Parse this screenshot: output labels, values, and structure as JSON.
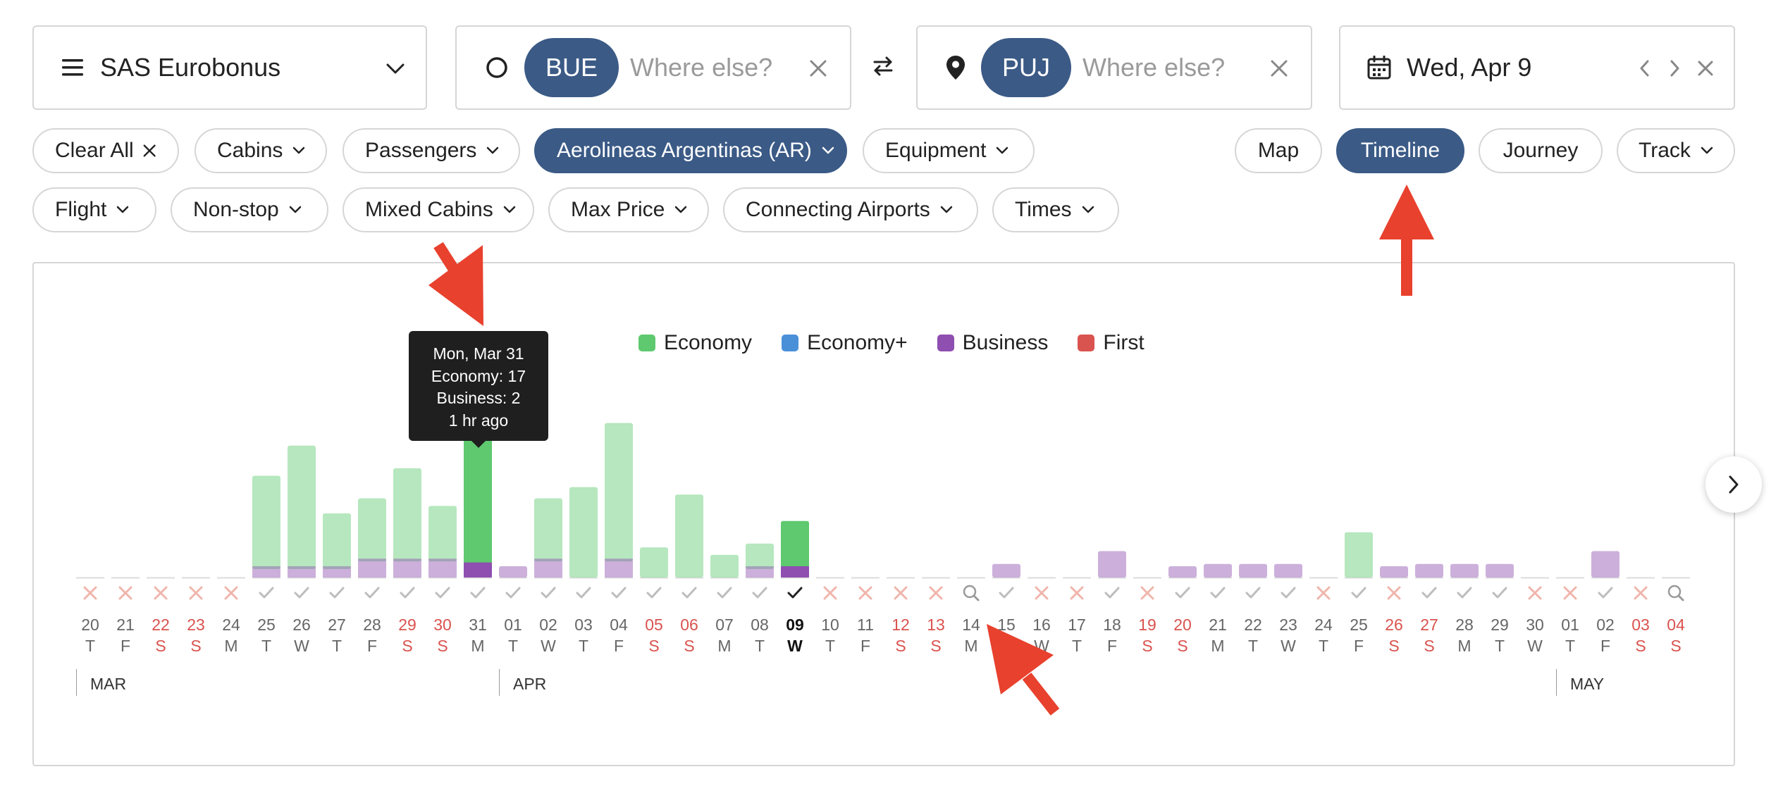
{
  "program": {
    "label": "SAS Eurobonus"
  },
  "origin": {
    "code": "BUE",
    "placeholder": "Where else?"
  },
  "destination": {
    "code": "PUJ",
    "placeholder": "Where else?"
  },
  "date": {
    "label": "Wed, Apr 9"
  },
  "filters": {
    "clear_all": "Clear All",
    "cabins": "Cabins",
    "passengers": "Passengers",
    "airline": "Aerolineas Argentinas (AR)",
    "equipment": "Equipment",
    "flight": "Flight",
    "nonstop": "Non-stop",
    "mixed_cabins": "Mixed Cabins",
    "max_price": "Max Price",
    "connecting_airports": "Connecting Airports",
    "times": "Times"
  },
  "views": {
    "map": "Map",
    "timeline": "Timeline",
    "journey": "Journey",
    "track": "Track",
    "active": "Timeline"
  },
  "legend": [
    {
      "label": "Economy",
      "color": "#5ec96f"
    },
    {
      "label": "Economy+",
      "color": "#4a90d9"
    },
    {
      "label": "Business",
      "color": "#8e4fb0"
    },
    {
      "label": "First",
      "color": "#d9534f"
    }
  ],
  "tooltip": {
    "line1": "Mon, Mar 31",
    "line2": "Economy: 17",
    "line3": "Business: 2",
    "line4": "1 hr ago"
  },
  "months": [
    {
      "label": "MAR",
      "start_index": 0
    },
    {
      "label": "APR",
      "start_index": 12
    },
    {
      "label": "MAY",
      "start_index": 42
    }
  ],
  "colors": {
    "economy": "#5ec96f",
    "business": "#8e4fb0",
    "brand": "#3b5a86",
    "weekend": "#d9534f",
    "arrow": "#e8412e"
  },
  "chart_data": {
    "type": "bar",
    "stacked": true,
    "title": "",
    "xlabel": "",
    "ylabel": "",
    "categories": [
      "20",
      "21",
      "22",
      "23",
      "24",
      "25",
      "26",
      "27",
      "28",
      "29",
      "30",
      "31",
      "01",
      "02",
      "03",
      "04",
      "05",
      "06",
      "07",
      "08",
      "09",
      "10",
      "11",
      "12",
      "13",
      "14",
      "15",
      "16",
      "17",
      "18",
      "19",
      "20",
      "21",
      "22",
      "23",
      "24",
      "25",
      "26",
      "27",
      "28",
      "29",
      "30",
      "01",
      "02",
      "03",
      "04"
    ],
    "weekdays": [
      "T",
      "F",
      "S",
      "S",
      "M",
      "T",
      "W",
      "T",
      "F",
      "S",
      "S",
      "M",
      "T",
      "W",
      "T",
      "F",
      "S",
      "S",
      "M",
      "T",
      "W",
      "T",
      "F",
      "S",
      "S",
      "M",
      "T",
      "W",
      "T",
      "F",
      "S",
      "S",
      "M",
      "T",
      "W",
      "T",
      "F",
      "S",
      "S",
      "M",
      "T",
      "W",
      "T",
      "F",
      "S",
      "S"
    ],
    "status": [
      "x",
      "x",
      "x",
      "x",
      "x",
      "check",
      "check",
      "check",
      "check",
      "check",
      "check",
      "check",
      "check",
      "check",
      "check",
      "check",
      "check",
      "check",
      "check",
      "check",
      "check",
      "x",
      "x",
      "x",
      "x",
      "search",
      "check",
      "x",
      "x",
      "check",
      "x",
      "check",
      "check",
      "check",
      "check",
      "x",
      "check",
      "x",
      "check",
      "check",
      "check",
      "x",
      "x",
      "check",
      "x",
      "search"
    ],
    "selected_index": 20,
    "highlighted_index": 11,
    "series": [
      {
        "name": "Economy",
        "values": [
          0,
          0,
          0,
          0,
          0,
          12,
          16,
          7,
          8,
          12,
          7,
          17,
          0,
          8,
          12,
          18,
          4,
          11,
          3,
          3,
          6,
          0,
          0,
          0,
          0,
          0,
          0,
          0,
          0,
          0,
          0,
          0,
          0,
          0,
          0,
          0,
          6,
          0,
          0,
          0,
          0,
          0,
          0,
          0,
          0,
          0
        ]
      },
      {
        "name": "Business",
        "values": [
          0,
          0,
          0,
          0,
          0,
          1.5,
          1.5,
          1.5,
          2.5,
          2.5,
          2.5,
          2,
          1.5,
          2.5,
          0,
          2.5,
          0,
          0,
          0,
          1.5,
          1.5,
          0,
          0,
          0,
          0,
          0,
          1.8,
          0,
          0,
          3.5,
          0,
          1.5,
          1.8,
          1.8,
          1.8,
          0,
          0,
          1.5,
          1.8,
          1.8,
          1.8,
          0,
          0,
          3.5,
          0,
          0
        ]
      }
    ],
    "ylim": [
      0,
      20
    ]
  }
}
